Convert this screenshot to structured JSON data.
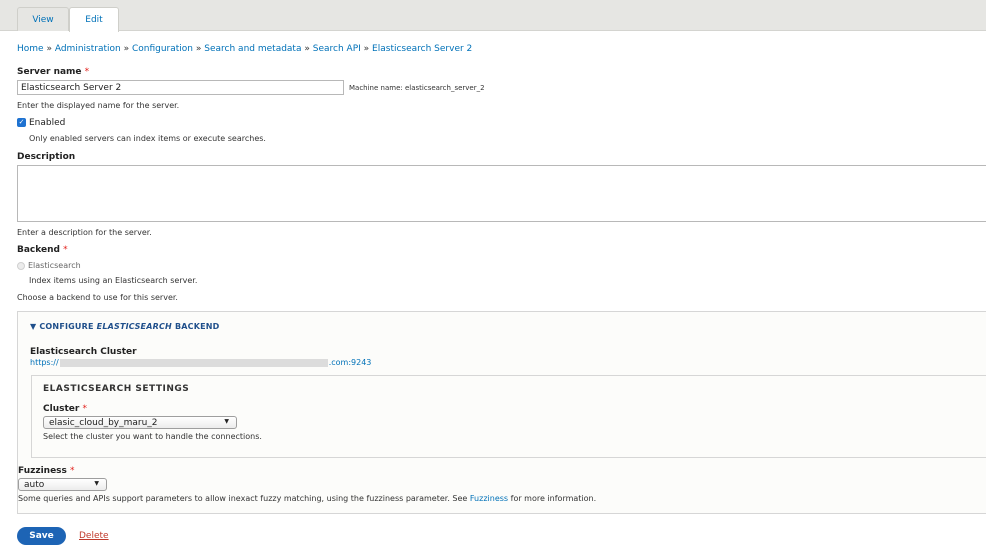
{
  "tabs": [
    {
      "label": "View"
    },
    {
      "label": "Edit"
    }
  ],
  "breadcrumb": {
    "items": [
      "Home",
      "Administration",
      "Configuration",
      "Search and metadata",
      "Search API",
      "Elasticsearch Server 2"
    ],
    "separator": "»"
  },
  "server_name": {
    "label": "Server name",
    "required_marker": "*",
    "value": "Elasticsearch Server 2",
    "machine_name": "Machine name: elasticsearch_server_2",
    "help": "Enter the displayed name for the server."
  },
  "enabled": {
    "label": "Enabled",
    "checked": true,
    "check_glyph": "✓",
    "help": "Only enabled servers can index items or execute searches."
  },
  "description": {
    "label": "Description",
    "value": "",
    "help": "Enter a description for the server."
  },
  "backend": {
    "label": "Backend",
    "required_marker": "*",
    "option": "Elasticsearch",
    "option_help": "Index items using an Elasticsearch server.",
    "help": "Choose a backend to use for this server."
  },
  "configure": {
    "toggle_glyph": "▼",
    "summary_prefix": "CONFIGURE",
    "summary_em": "ELASTICSEARCH",
    "summary_suffix": "BACKEND",
    "cluster_label": "Elasticsearch Cluster",
    "url_prefix": "https://",
    "url_suffix": ".com:9243",
    "settings": {
      "title": "ELASTICSEARCH SETTINGS",
      "cluster_label": "Cluster",
      "required_marker": "*",
      "cluster_value": "elasic_cloud_by_maru_2",
      "cluster_help": "Select the cluster you want to handle the connections."
    },
    "fuzziness": {
      "label": "Fuzziness",
      "required_marker": "*",
      "value": "auto",
      "help_prefix": "Some queries and APIs support parameters to allow inexact fuzzy matching, using the fuzziness parameter. See",
      "help_link": "Fuzziness",
      "help_suffix": "for more information."
    }
  },
  "actions": {
    "save": "Save",
    "delete": "Delete"
  },
  "colors": {
    "link": "#0071b8",
    "primary_button": "#1d64b5",
    "required": "#e2211c",
    "delete": "#c0392b"
  }
}
